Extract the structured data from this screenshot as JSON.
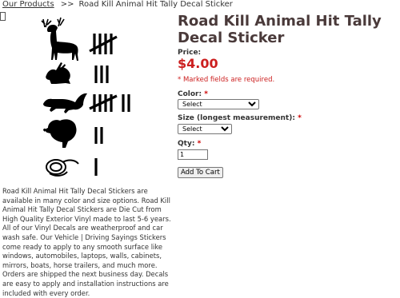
{
  "breadcrumb": {
    "root": "Our Products",
    "separator": ">>",
    "current": "Road Kill Animal Hit Tally Decal Sticker"
  },
  "product": {
    "title": "Road Kill Animal Hit Tally Decal Sticker",
    "price_label": "Price:",
    "price": "$4.00",
    "required_note": "* Marked fields are required.",
    "color_label": "Color:",
    "color_selected": "Select",
    "size_label": "Size (longest measurement):",
    "size_selected": "Select",
    "qty_label": "Qty:",
    "qty_value": "1",
    "required_mark": "*",
    "add_to_cart": "Add To Cart",
    "description": "Road Kill Animal Hit Tally Decal Stickers are available in many color and size options. Road Kill Animal Hit Tally Decal Stickers are Die Cut from High Quality Exterior Vinyl made to last 5-6 years. All of our Vinyl Decals are weatherproof and car wash safe. Our Vehicle | Driving Sayings Stickers come ready to apply to any smooth surface like windows, automobiles, laptops, walls, cabinets, mirrors, boats, horse trailers, and much more. Orders are shipped the next business day. Decals are easy to apply and installation instructions are included with every order."
  },
  "artwork": {
    "rows": [
      {
        "animal": "deer-icon",
        "tally": 5
      },
      {
        "animal": "rabbit-icon",
        "tally": 3
      },
      {
        "animal": "squirrel-icon",
        "tally": 7
      },
      {
        "animal": "turkey-icon",
        "tally": 2
      },
      {
        "animal": "snake-icon",
        "tally": 1
      }
    ],
    "color": "#000000"
  },
  "colors": {
    "price": "#cc1f1f",
    "title": "#4a3a3a",
    "required": "#cc0000"
  }
}
